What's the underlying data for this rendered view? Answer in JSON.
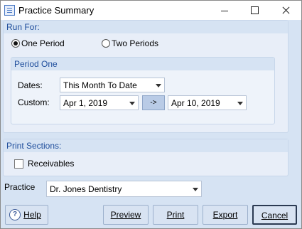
{
  "window": {
    "title": "Practice Summary"
  },
  "run_for": {
    "header": "Run For:",
    "one_period": "One Period",
    "two_periods": "Two Periods",
    "selected": "One Period"
  },
  "period_one": {
    "header": "Period One",
    "dates_label": "Dates:",
    "dates_value": "This Month To Date",
    "custom_label": "Custom:",
    "from_date": "Apr 1, 2019",
    "arrow_label": "->",
    "to_date": "Apr 10, 2019"
  },
  "print_sections": {
    "header": "Print Sections:",
    "receivables": "Receivables",
    "receivables_checked": false
  },
  "practice": {
    "label": "Practice",
    "value": "Dr. Jones Dentistry"
  },
  "buttons": {
    "help": "Help",
    "preview": "Preview",
    "print": "Print",
    "export": "Export",
    "cancel": "Cancel"
  }
}
